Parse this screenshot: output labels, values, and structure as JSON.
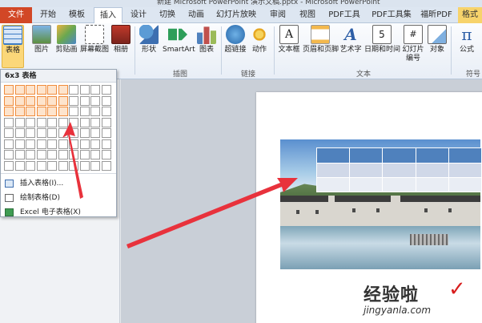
{
  "window": {
    "title_fragment": "新建 Microsoft PowerPoint 演示文稿.pptx - Microsoft PowerPoint"
  },
  "tabs": [
    {
      "label": "文件"
    },
    {
      "label": "开始"
    },
    {
      "label": "模板"
    },
    {
      "label": "插入"
    },
    {
      "label": "设计"
    },
    {
      "label": "切换"
    },
    {
      "label": "动画"
    },
    {
      "label": "幻灯片放映"
    },
    {
      "label": "审阅"
    },
    {
      "label": "视图"
    },
    {
      "label": "PDF工具"
    },
    {
      "label": "PDF工具集"
    },
    {
      "label": "福昕PDF"
    },
    {
      "label": "格式"
    }
  ],
  "ribbon": {
    "buttons": [
      {
        "label": "表格",
        "icon": "table-icon"
      },
      {
        "label": "图片",
        "icon": "picture-icon"
      },
      {
        "label": "剪贴画",
        "icon": "clipart-icon"
      },
      {
        "label": "屏幕截图",
        "icon": "screenshot-icon"
      },
      {
        "label": "相册",
        "icon": "album-icon"
      },
      {
        "label": "形状",
        "icon": "shapes-icon"
      },
      {
        "label": "SmartArt",
        "icon": "smartart-icon"
      },
      {
        "label": "图表",
        "icon": "chart-icon"
      },
      {
        "label": "超链接",
        "icon": "hyperlink-icon"
      },
      {
        "label": "动作",
        "icon": "action-icon"
      },
      {
        "label": "文本框",
        "icon": "textbox-icon"
      },
      {
        "label": "页眉和页脚",
        "icon": "header-footer-icon"
      },
      {
        "label": "艺术字",
        "icon": "wordart-icon"
      },
      {
        "label": "日期和时间",
        "icon": "datetime-icon"
      },
      {
        "label": "幻灯片编号",
        "icon": "slide-number-icon"
      },
      {
        "label": "对象",
        "icon": "object-icon"
      },
      {
        "label": "公式",
        "icon": "equation-icon"
      }
    ],
    "groups": {
      "illustrations": "插图",
      "links": "链接",
      "text": "文本",
      "symbols": "符号"
    }
  },
  "dropdown": {
    "title": "6x3 表格",
    "grid": {
      "cols": 10,
      "rows": 8,
      "selected_cols": 6,
      "selected_rows": 3
    },
    "items": [
      {
        "label": "插入表格(I)...",
        "icon": "insert-table-icon"
      },
      {
        "label": "绘制表格(D)",
        "icon": "draw-table-icon"
      },
      {
        "label": "Excel 电子表格(X)",
        "icon": "excel-icon"
      }
    ]
  },
  "watermark": {
    "text": "经验啦",
    "check": "✓",
    "url": "jingyanla.com"
  },
  "colors": {
    "file_tab": "#d24726",
    "active_button": "#fbd779",
    "table_header": "#4f81bd",
    "grid_selection": "#f08c3c",
    "arrow": "#e8323c"
  }
}
